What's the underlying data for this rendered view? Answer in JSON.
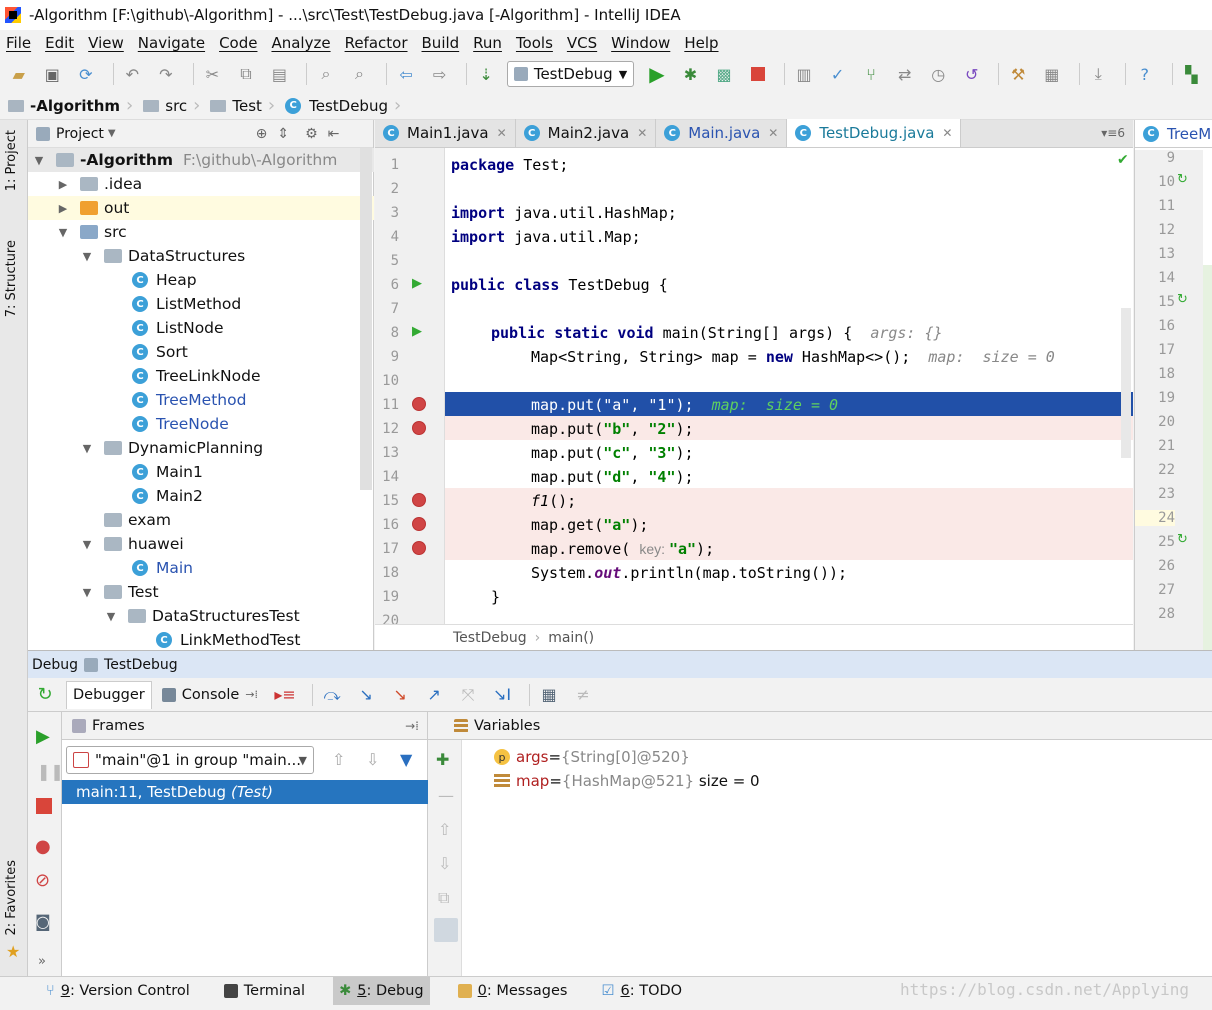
{
  "window": {
    "title": "-Algorithm [F:\\github\\-Algorithm] - ...\\src\\Test\\TestDebug.java [-Algorithm] - IntelliJ IDEA"
  },
  "menu": [
    "File",
    "Edit",
    "View",
    "Navigate",
    "Code",
    "Analyze",
    "Refactor",
    "Build",
    "Run",
    "Tools",
    "VCS",
    "Window",
    "Help"
  ],
  "toolbar": {
    "run_config": "TestDebug"
  },
  "breadcrumb": [
    "-Algorithm",
    "src",
    "Test",
    "TestDebug"
  ],
  "sidebar": {
    "project_tab": "1: Project",
    "structure_tab": "7: Structure",
    "favorites_tab": "2: Favorites"
  },
  "project": {
    "header": "Project",
    "root_name": "-Algorithm",
    "root_path": "F:\\github\\-Algorithm",
    "items": [
      {
        "label": ".idea"
      },
      {
        "label": "out"
      },
      {
        "label": "src"
      },
      {
        "label": "DataStructures"
      },
      {
        "label": "Heap"
      },
      {
        "label": "ListMethod"
      },
      {
        "label": "ListNode"
      },
      {
        "label": "Sort"
      },
      {
        "label": "TreeLinkNode"
      },
      {
        "label": "TreeMethod"
      },
      {
        "label": "TreeNode"
      },
      {
        "label": "DynamicPlanning"
      },
      {
        "label": "Main1"
      },
      {
        "label": "Main2"
      },
      {
        "label": "exam"
      },
      {
        "label": "huawei"
      },
      {
        "label": "Main"
      },
      {
        "label": "Test"
      },
      {
        "label": "DataStructuresTest"
      },
      {
        "label": "LinkMethodTest"
      }
    ]
  },
  "editor": {
    "tabs": [
      "Main1.java",
      "Main2.java",
      "Main.java",
      "TestDebug.java"
    ],
    "split_tab": "TreeM",
    "tab_count": "6",
    "line_numbers": [
      "1",
      "2",
      "3",
      "4",
      "5",
      "6",
      "7",
      "8",
      "9",
      "10",
      "11",
      "12",
      "13",
      "14",
      "15",
      "16",
      "17",
      "18",
      "19",
      "20"
    ],
    "lines": {
      "l1a": "package",
      "l1b": " Test;",
      "l3a": "import",
      "l3b": " java.util.HashMap;",
      "l4a": "import",
      "l4b": " java.util.Map;",
      "l6a": "public class",
      "l6b": " TestDebug {",
      "l8a": "public static void",
      "l8b": " main(String[] args) {  ",
      "l8c": "args: {}",
      "l9a": "Map<String, String> map = ",
      "l9b": "new",
      "l9c": " HashMap<>();  ",
      "l9d": "map:  size = 0",
      "l11a": "map.put(\"a\", \"1\");  ",
      "l11b": "map:  size = 0",
      "l12a": "map.put(",
      "l12b": "\"b\"",
      "l12c": ", ",
      "l12d": "\"2\"",
      "l12e": ");",
      "l13a": "map.put(",
      "l13b": "\"c\"",
      "l13c": ", ",
      "l13d": "\"3\"",
      "l13e": ");",
      "l14a": "map.put(",
      "l14b": "\"d\"",
      "l14c": ", ",
      "l14d": "\"4\"",
      "l14e": ");",
      "l15a": "f1",
      "l15b": "();",
      "l16a": "map.get(",
      "l16b": "\"a\"",
      "l16c": ");",
      "l17a": "map.remove( ",
      "l17b": "key: ",
      "l17c": "\"a\"",
      "l17d": ");",
      "l18a": "System.",
      "l18b": "out",
      "l18c": ".println(map.toString());",
      "l19a": "}"
    },
    "footer_class": "TestDebug",
    "footer_method": "main()",
    "right_line_numbers": [
      "9",
      "10",
      "11",
      "12",
      "13",
      "14",
      "15",
      "16",
      "17",
      "18",
      "19",
      "20",
      "21",
      "22",
      "23",
      "24",
      "25",
      "26",
      "27",
      "28"
    ]
  },
  "debug": {
    "header_label": "Debug",
    "session": "TestDebug",
    "tabs": {
      "debugger": "Debugger",
      "console": "Console"
    },
    "frames_title": "Frames",
    "thread": "\"main\"@1 in group \"main...",
    "frame": "main:11, TestDebug",
    "frame_pkg": "(Test)",
    "variables_title": "Variables",
    "variables": [
      {
        "name": "args",
        "eq": " = ",
        "value": "{String[0]@520}",
        "extra": ""
      },
      {
        "name": "map",
        "eq": " = ",
        "value": "{HashMap@521}",
        "extra": " size = 0"
      }
    ]
  },
  "statusbar": {
    "tabs": [
      {
        "key": "9",
        "label": ": Version Control"
      },
      {
        "key": "",
        "label": "Terminal"
      },
      {
        "key": "5",
        "label": ": Debug"
      },
      {
        "key": "0",
        "label": ": Messages"
      },
      {
        "key": "6",
        "label": ": TODO"
      }
    ],
    "watermark": "https://blog.csdn.net/Applying"
  },
  "colors": {
    "selection": "#2150a8",
    "breakpoint": "#d04545",
    "frame_selected": "#2675bf"
  }
}
